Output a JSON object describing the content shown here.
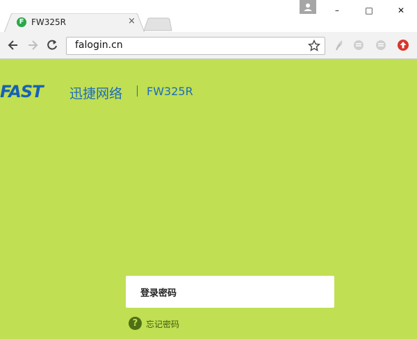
{
  "browser": {
    "tab": {
      "title": "FW325R",
      "favicon_letter": "F",
      "close_glyph": "×"
    },
    "window_controls": {
      "minimize": "–",
      "maximize": "□",
      "close": "✕"
    },
    "address_bar": {
      "url": "falogin.cn"
    }
  },
  "page": {
    "brand": {
      "logo_text": "FAST",
      "chinese_name": "迅捷网络",
      "model": "FW325R"
    },
    "login": {
      "password_label": "登录密码",
      "forgot_password": "忘记密码",
      "help_glyph": "?"
    }
  },
  "colors": {
    "page_background": "#c0df52",
    "brand_blue": "#1c6bbf",
    "help_green": "#4f6f14"
  }
}
